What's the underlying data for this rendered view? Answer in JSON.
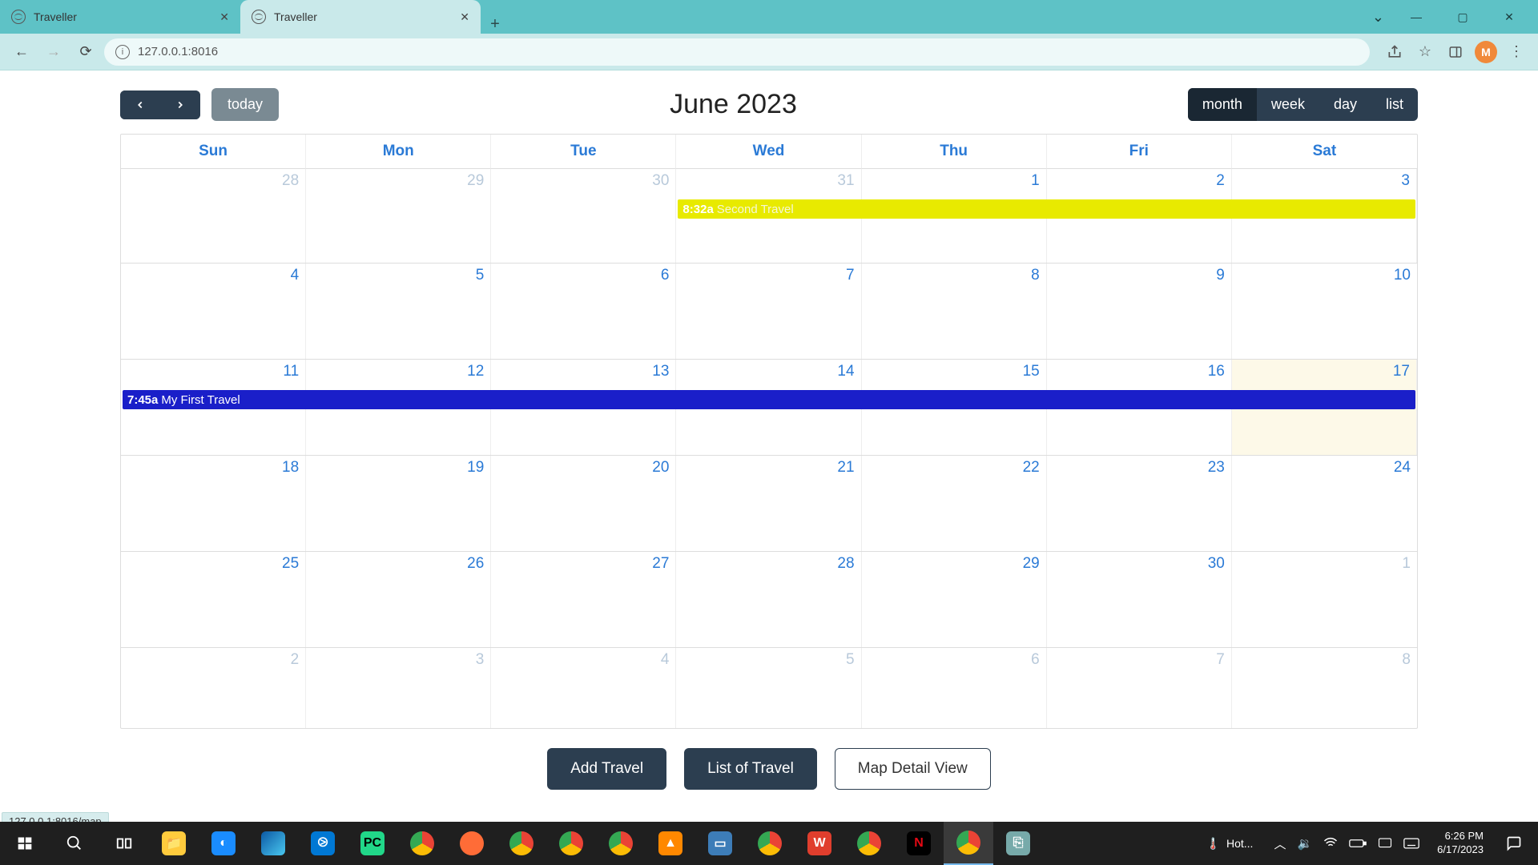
{
  "browser": {
    "tabs": [
      {
        "title": "Traveller",
        "active": false
      },
      {
        "title": "Traveller",
        "active": true
      }
    ],
    "url": "127.0.0.1:8016",
    "avatar_letter": "M",
    "status_hover": "127.0.0.1:8016/map"
  },
  "calendar": {
    "title": "June 2023",
    "nav": {
      "prev": "‹",
      "next": "›",
      "today": "today"
    },
    "views": {
      "month": "month",
      "week": "week",
      "day": "day",
      "list": "list",
      "active": "month"
    },
    "daynames": [
      "Sun",
      "Mon",
      "Tue",
      "Wed",
      "Thu",
      "Fri",
      "Sat"
    ],
    "weeks": [
      {
        "days": [
          {
            "n": "28",
            "other": true
          },
          {
            "n": "29",
            "other": true
          },
          {
            "n": "30",
            "other": true
          },
          {
            "n": "31",
            "other": true
          },
          {
            "n": "1"
          },
          {
            "n": "2"
          },
          {
            "n": "3"
          }
        ],
        "event": {
          "time": "8:32a",
          "title": "Second Travel",
          "cls": "ev-yellow ev-start-col3"
        }
      },
      {
        "days": [
          {
            "n": "4"
          },
          {
            "n": "5"
          },
          {
            "n": "6"
          },
          {
            "n": "7"
          },
          {
            "n": "8"
          },
          {
            "n": "9"
          },
          {
            "n": "10"
          }
        ]
      },
      {
        "days": [
          {
            "n": "11"
          },
          {
            "n": "12"
          },
          {
            "n": "13"
          },
          {
            "n": "14"
          },
          {
            "n": "15"
          },
          {
            "n": "16"
          },
          {
            "n": "17",
            "today": true
          }
        ],
        "event": {
          "time": "7:45a",
          "title": "My First Travel",
          "cls": "ev-blue"
        }
      },
      {
        "days": [
          {
            "n": "18"
          },
          {
            "n": "19"
          },
          {
            "n": "20"
          },
          {
            "n": "21"
          },
          {
            "n": "22"
          },
          {
            "n": "23"
          },
          {
            "n": "24"
          }
        ]
      },
      {
        "days": [
          {
            "n": "25"
          },
          {
            "n": "26"
          },
          {
            "n": "27"
          },
          {
            "n": "28"
          },
          {
            "n": "29"
          },
          {
            "n": "30"
          },
          {
            "n": "1",
            "other": true
          }
        ]
      },
      {
        "days": [
          {
            "n": "2",
            "other": true
          },
          {
            "n": "3",
            "other": true
          },
          {
            "n": "4",
            "other": true
          },
          {
            "n": "5",
            "other": true
          },
          {
            "n": "6",
            "other": true
          },
          {
            "n": "7",
            "other": true
          },
          {
            "n": "8",
            "other": true
          }
        ]
      }
    ]
  },
  "buttons": {
    "add": "Add Travel",
    "list": "List of Travel",
    "map": "Map Detail View"
  },
  "taskbar": {
    "weather": "Hot...",
    "time": "6:26 PM",
    "date": "6/17/2023"
  }
}
